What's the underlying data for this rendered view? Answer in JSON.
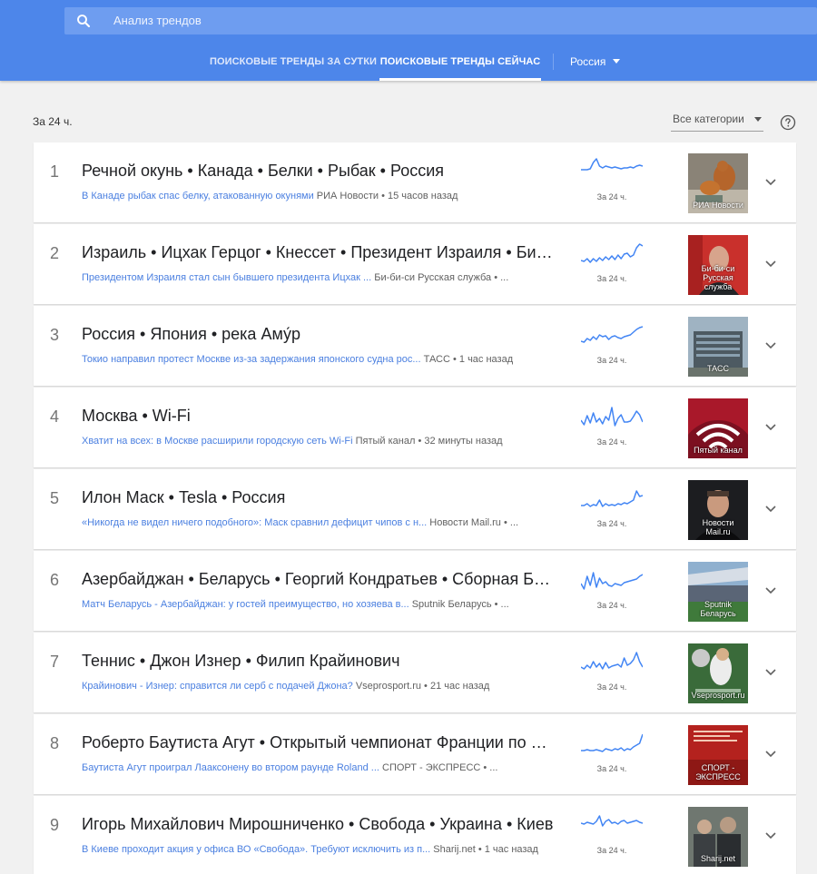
{
  "header": {
    "search_placeholder": "Анализ трендов",
    "tabs": [
      {
        "label": "ПОИСКОВЫЕ ТРЕНДЫ ЗА СУТКИ",
        "active": false
      },
      {
        "label": "ПОИСКОВЫЕ ТРЕНДЫ СЕЙЧАС",
        "active": true
      }
    ],
    "geo": "Россия",
    "colors": {
      "bar": "#4d86ea",
      "link": "#4a7fe0",
      "spark": "#4285f4"
    }
  },
  "filters": {
    "period": "За 24 ч.",
    "category": "Все категории",
    "help_icon": "help-circle-icon"
  },
  "trends": [
    {
      "rank": "1",
      "title": "Речной окунь • Канада • Белки • Рыбак • Россия",
      "article": "В Канаде рыбак спас белку, атакованную окунями",
      "source": " РИА Новости • 15 часов назад",
      "spark_label": "За 24 ч.",
      "thumb_caption": "РИА Новости",
      "thumb_theme": "squirrel"
    },
    {
      "rank": "2",
      "title": "Израиль • Ицхак Герцог • Кнессет • Президент Израиля • Биньямин Нетаньяху",
      "article": "Президентом Израиля стал сын бывшего президента Ицхак ...",
      "source": " Би-би-си Русская служба • ...",
      "spark_label": "За 24 ч.",
      "thumb_caption": "Би-би-си Русская служба",
      "thumb_theme": "portrait-red"
    },
    {
      "rank": "3",
      "title": "Россия • Япония • река Аму́р",
      "article": "Токио направил протест Москве из-за задержания японского судна рос...",
      "source": " ТАСС • 1 час назад",
      "spark_label": "За 24 ч.",
      "thumb_caption": "ТАСС",
      "thumb_theme": "building"
    },
    {
      "rank": "4",
      "title": "Москва • Wi-Fi",
      "article": "Хватит на всех: в Москве расширили городскую сеть Wi-Fi",
      "source": " Пятый канал • 32 минуты назад",
      "spark_label": "За 24 ч.",
      "thumb_caption": "Пятый канал",
      "thumb_theme": "wifi"
    },
    {
      "rank": "5",
      "title": "Илон Маск • Tesla • Россия",
      "article": "«Никогда не видел ничего подобного»: Маск сравнил дефицит чипов с н...",
      "source": " Новости Mail.ru • ...",
      "spark_label": "За 24 ч.",
      "thumb_caption": "Новости Mail.ru",
      "thumb_theme": "portrait-dark"
    },
    {
      "rank": "6",
      "title": "Азербайджан • Беларусь • Георгий Кондратьев • Сборная Беларуси по футболу",
      "article": "Матч Беларусь - Азербайджан: у гостей преимущество, но хозяева в...",
      "source": " Sputnik Беларусь • ...",
      "spark_label": "За 24 ч.",
      "thumb_caption": "Sputnik Беларусь",
      "thumb_theme": "stadium"
    },
    {
      "rank": "7",
      "title": "Теннис • Джон Изнер • Филип Крайинович",
      "article": "Крайинович - Изнер: справится ли серб с подачей Джона?",
      "source": " Vseprosport.ru • 21 час назад",
      "spark_label": "За 24 ч.",
      "thumb_caption": "Vseprosport.ru",
      "thumb_theme": "tennis"
    },
    {
      "rank": "8",
      "title": "Роберто Баутиста Агут • Открытый чемпионат Франции по теннису",
      "article": "Баутиста Агут проиграл Лаакcонену во втором раунде Roland ...",
      "source": " СПОРТ - ЭКСПРЕСС • ...",
      "spark_label": "За 24 ч.",
      "thumb_caption": "СПОРТ - ЭКСПРЕСС",
      "thumb_theme": "sport-red"
    },
    {
      "rank": "9",
      "title": "Игорь Михайлович Мирошниченко • Свобода • Украина • Киев",
      "article": "В Киеве проходит акция у офиса ВО «Свобода». Требуют исключить из п...",
      "source": " Sharij.net • 1 час назад",
      "spark_label": "За 24 ч.",
      "thumb_caption": "Sharij.net",
      "thumb_theme": "crowd"
    }
  ]
}
